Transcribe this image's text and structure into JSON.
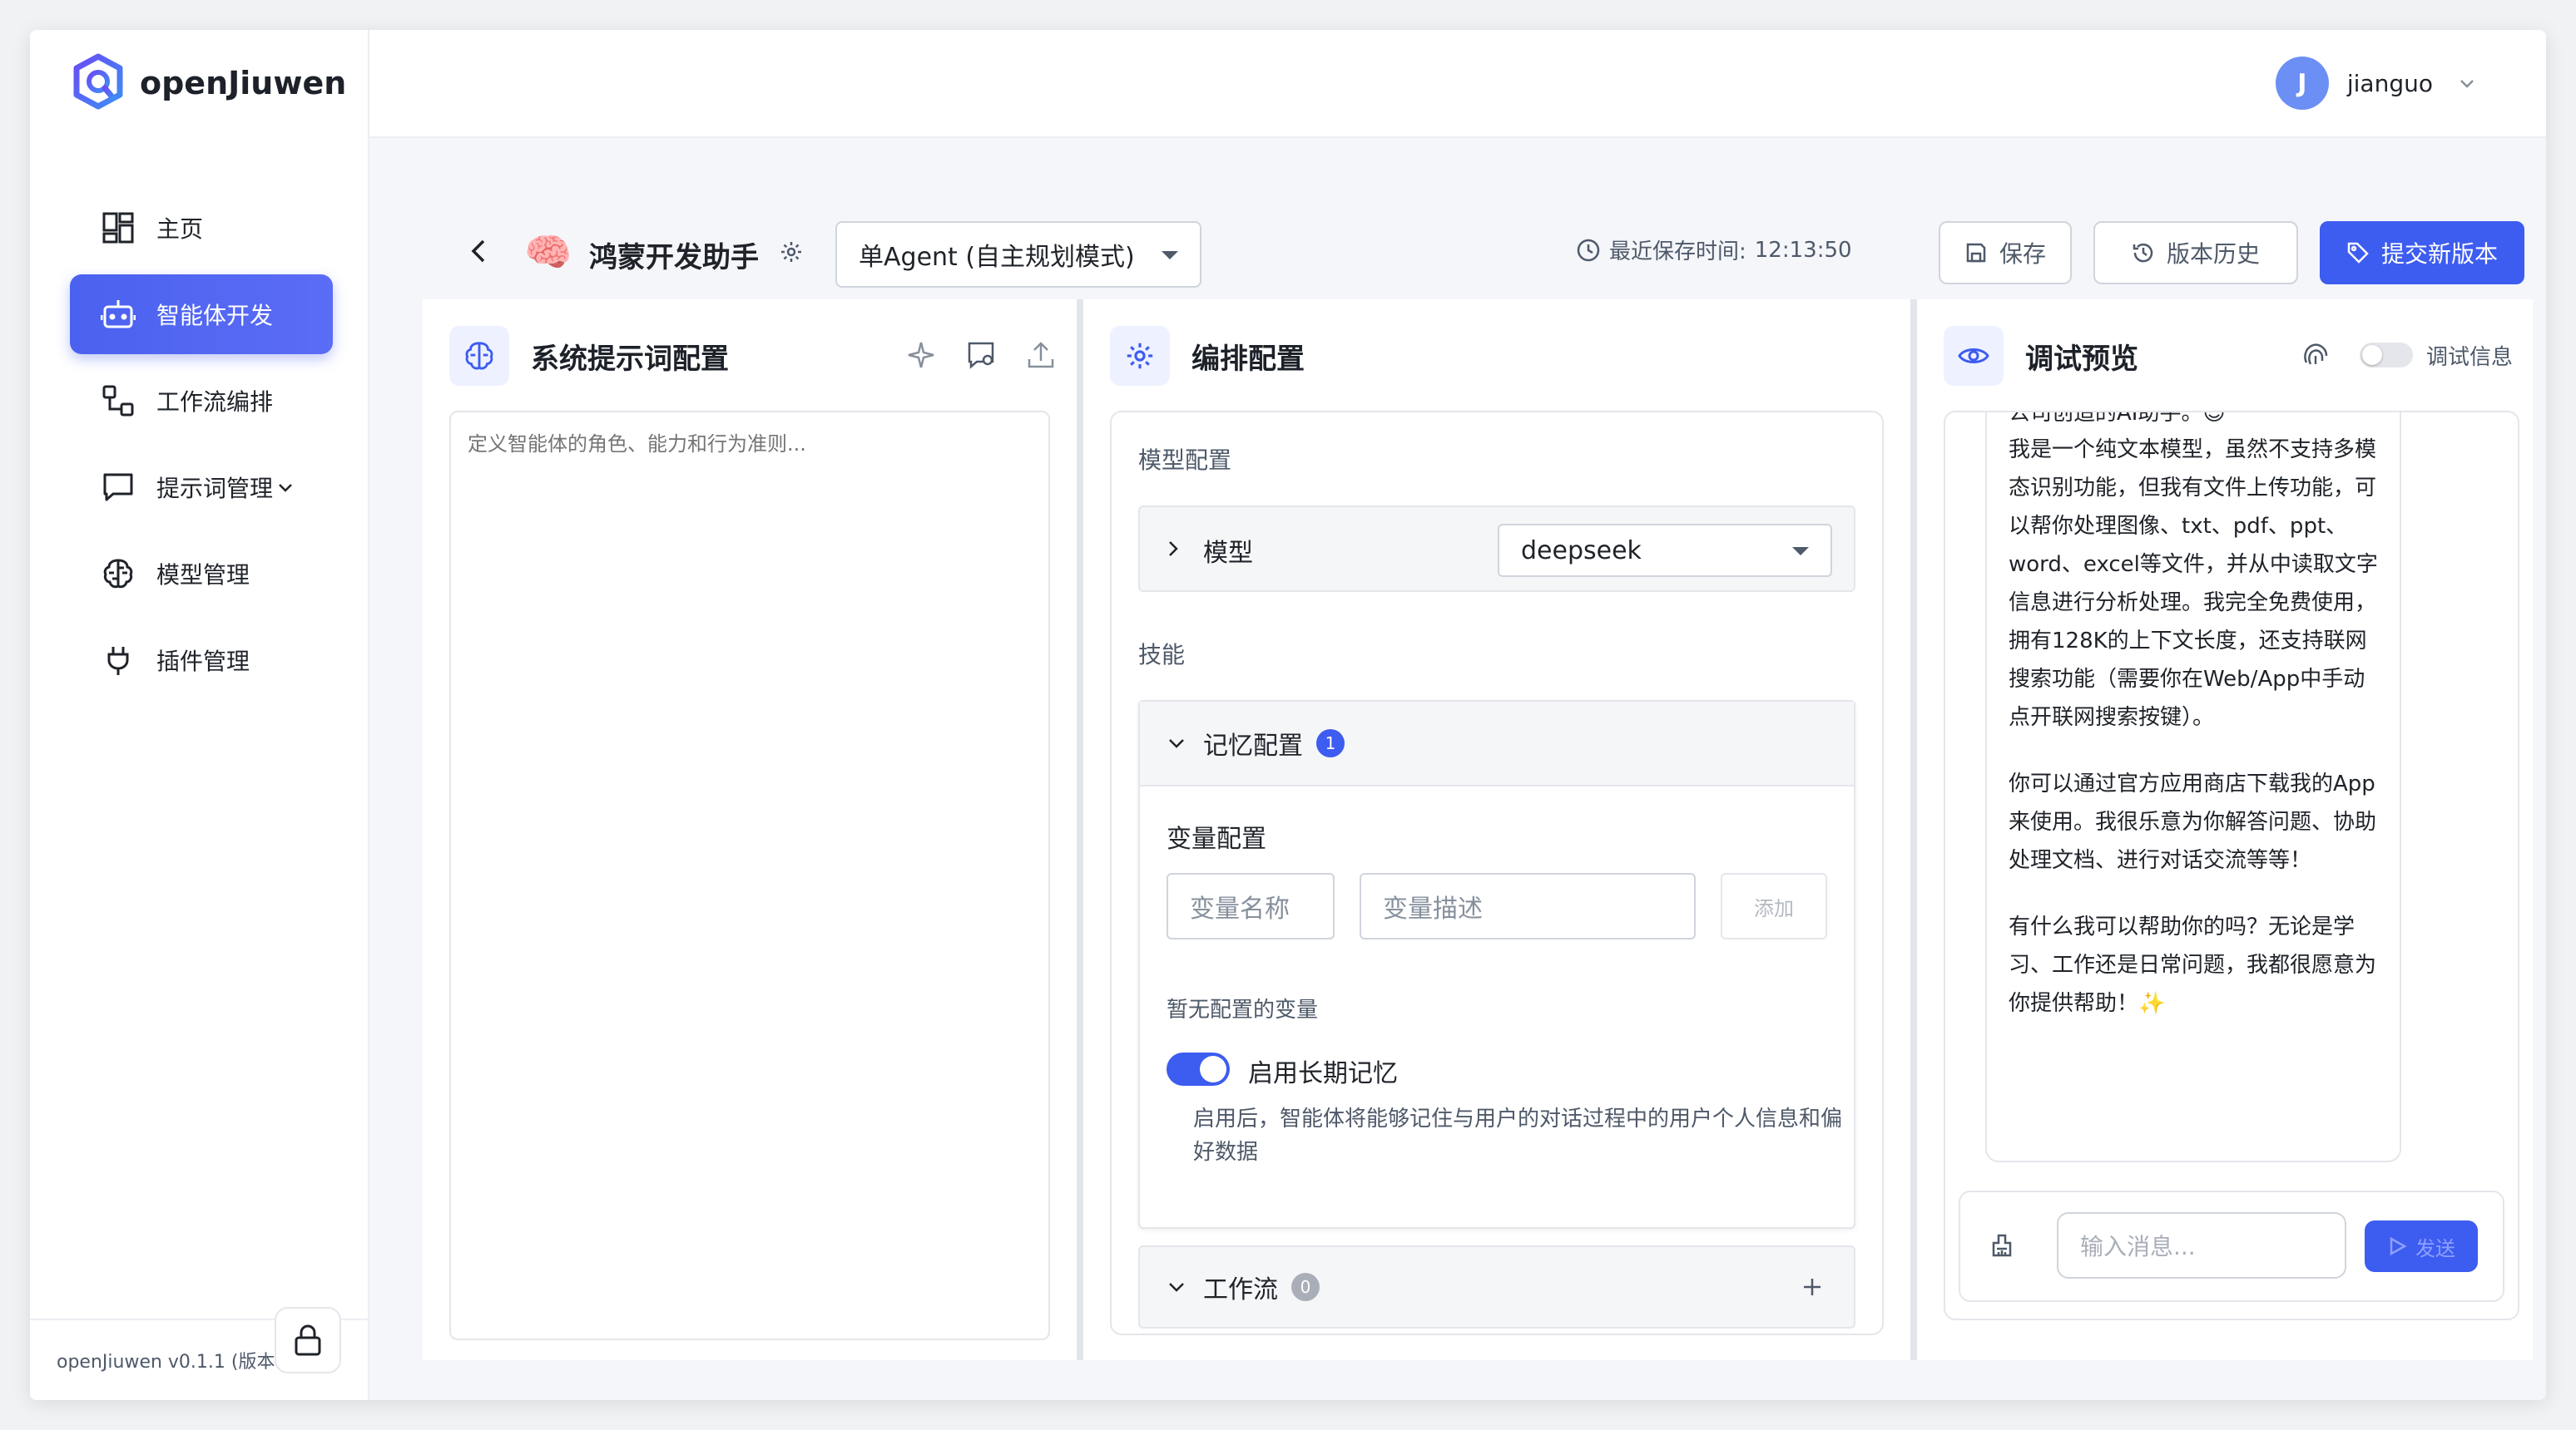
{
  "app": {
    "name": "openJiuwen",
    "version": "openJiuwen v0.1.1 (版本"
  },
  "user": {
    "initial": "J",
    "name": "jianguo"
  },
  "sidebar": {
    "items": [
      {
        "label": "主页",
        "icon": "home-grid-icon",
        "active": false
      },
      {
        "label": "智能体开发",
        "icon": "robot-icon",
        "active": true
      },
      {
        "label": "工作流编排",
        "icon": "workflow-icon",
        "active": false
      },
      {
        "label": "提示词管理",
        "icon": "chat-bubble-icon",
        "active": false
      },
      {
        "label": "模型管理",
        "icon": "brain-icon",
        "active": false
      },
      {
        "label": "插件管理",
        "icon": "plug-icon",
        "active": false
      }
    ]
  },
  "header": {
    "agent_emoji": "🧠",
    "agent_name": "鸿蒙开发助手",
    "mode": "单Agent (自主规划模式)",
    "save_time_label": "最近保存时间:",
    "save_time": "12:13:50",
    "save_button": "保存",
    "history_button": "版本历史",
    "submit_button": "提交新版本"
  },
  "prompt_panel": {
    "title": "系统提示词配置",
    "placeholder": "定义智能体的角色、能力和行为准则..."
  },
  "orchestration_panel": {
    "title": "编排配置",
    "model_section": "模型配置",
    "model_label": "模型",
    "model_value": "deepseek",
    "skills_section": "技能",
    "memory": {
      "label": "记忆配置",
      "count": "1",
      "var_title": "变量配置",
      "var_name_placeholder": "变量名称",
      "var_desc_placeholder": "变量描述",
      "add_button": "添加",
      "empty_text": "暂无配置的变量",
      "ltm_label": "启用长期记忆",
      "ltm_desc": "启用后，智能体将能够记住与用户的对话过程中的用户个人信息和偏好数据"
    },
    "workflow": {
      "label": "工作流",
      "count": "0"
    }
  },
  "debug_panel": {
    "title": "调试预览",
    "debug_info_label": "调试信息",
    "message_cut": "公司创造的AI助手。😊",
    "message_paragraphs": [
      "我是一个纯文本模型，虽然不支持多模态识别功能，但我有文件上传功能，可以帮你处理图像、txt、pdf、ppt、word、excel等文件，并从中读取文字信息进行分析处理。我完全免费使用，拥有128K的上下文长度，还支持联网搜索功能（需要你在Web/App中手动点开联网搜索按键）。",
      "你可以通过官方应用商店下载我的App来使用。我很乐意为你解答问题、协助处理文档、进行对话交流等等！",
      "有什么我可以帮助你的吗？无论是学习、工作还是日常问题，我都很愿意为你提供帮助！✨"
    ],
    "input_placeholder": "输入消息...",
    "send_button": "发送"
  },
  "colors": {
    "accent": "#3d5cf0",
    "active_nav": "#4a62ef"
  }
}
